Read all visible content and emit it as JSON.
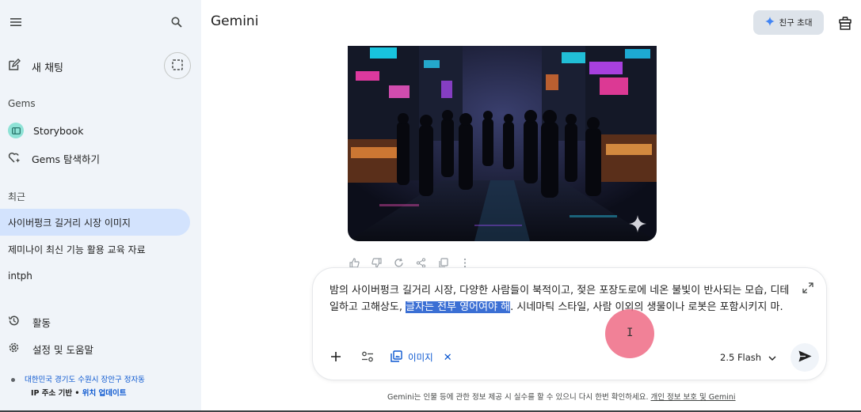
{
  "app": {
    "title": "Gemini"
  },
  "sidebar": {
    "new_chat_label": "새 채팅",
    "gems_section_label": "Gems",
    "gems": [
      {
        "label": "Storybook",
        "icon": "book-icon",
        "icon_bg": "#8ee2d6"
      },
      {
        "label": "Gems 탐색하기",
        "icon": "gem-heart-icon"
      }
    ],
    "recent_section_label": "최근",
    "recent": [
      {
        "label": "사이버펑크 길거리 시장 이미지",
        "active": true
      },
      {
        "label": "제미나이 최신 기능 활용 교육 자료",
        "active": false
      },
      {
        "label": "intph",
        "active": false
      }
    ],
    "activity_label": "활동",
    "settings_label": "설정 및 도움말",
    "location_place": "대한민국 경기도 수원시 장안구 정자동",
    "location_basis": "IP 주소 기반",
    "location_separator": " • ",
    "location_update": "위치 업데이트"
  },
  "header": {
    "invite_label": "친구 초대"
  },
  "composer": {
    "text_before": "밤의 사이버펑크 길거리 시장, 다양한 사람들이 북적이고, 젖은 포장도로에 네온 불빛이 반사되는 모습, 디테일하고 고해상도, ",
    "text_selected": "글자는 전부 영어여야 해",
    "text_after": ". 시네마틱 스타일, 사람 이외의 생물이나 로봇은 포함시키지 마.",
    "attachment_chip_label": "이미지",
    "model_label": "2.5 Flash"
  },
  "footer": {
    "disclaimer": "Gemini는 인물 등에 관한 정보 제공 시 실수를 할 수 있으니 다시 한번 확인하세요.",
    "privacy_link": "개인 정보 보호 및 Gemini"
  },
  "colors": {
    "sidebar_bg": "#f0f4f9",
    "active_item_bg": "#d3e3fd",
    "accent_blue": "#0b57d0",
    "selection_bg": "#3b6fd4",
    "invite_btn_bg": "#dde3ea",
    "cursor_highlight": "#ef6b85"
  }
}
